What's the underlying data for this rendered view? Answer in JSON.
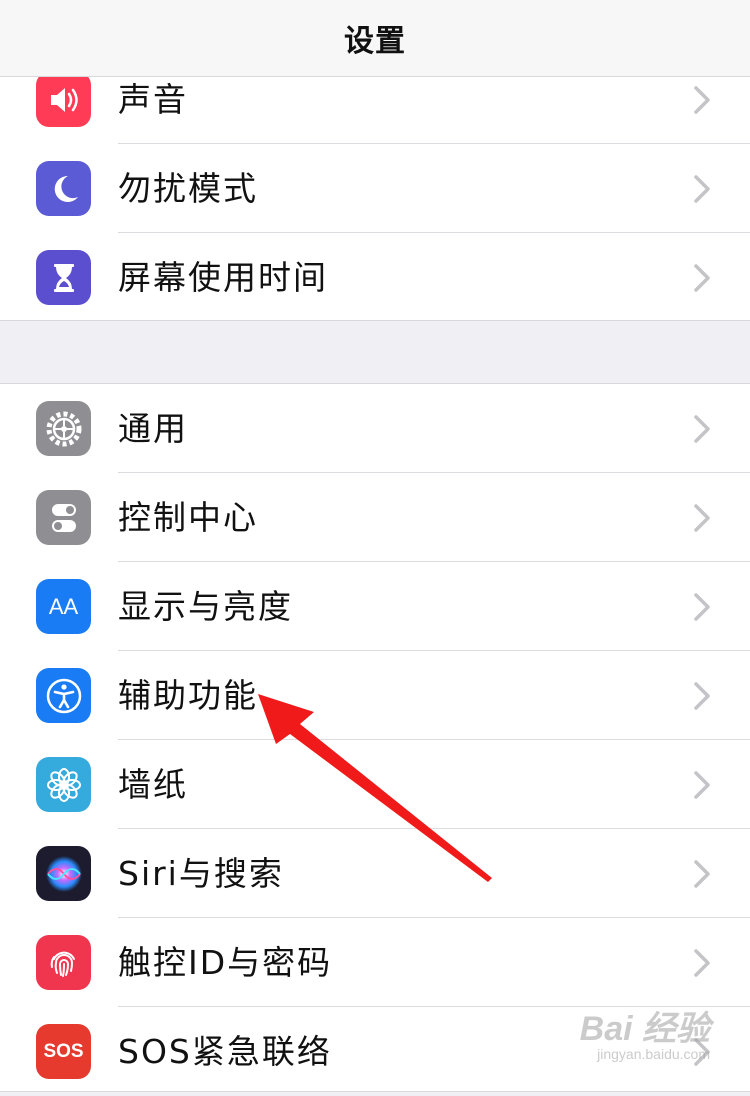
{
  "header": {
    "title": "设置"
  },
  "groups": [
    {
      "items": [
        {
          "label": "声音",
          "icon": "speaker-icon",
          "color": "#ff3b55"
        },
        {
          "label": "勿扰模式",
          "icon": "moon-icon",
          "color": "#5b5bd6"
        },
        {
          "label": "屏幕使用时间",
          "icon": "hourglass-icon",
          "color": "#5b4fcf"
        }
      ]
    },
    {
      "items": [
        {
          "label": "通用",
          "icon": "gear-icon",
          "color": "#8e8e93"
        },
        {
          "label": "控制中心",
          "icon": "toggles-icon",
          "color": "#8e8e93"
        },
        {
          "label": "显示与亮度",
          "icon": "text-size-icon",
          "glyph": "AA",
          "color": "#1a7cf5"
        },
        {
          "label": "辅助功能",
          "icon": "accessibility-icon",
          "color": "#1a7cf5"
        },
        {
          "label": "墙纸",
          "icon": "flower-icon",
          "color": "#35aadc"
        },
        {
          "label": "Siri与搜索",
          "icon": "siri-icon",
          "color": "#1c1c2e"
        },
        {
          "label": "触控ID与密码",
          "icon": "fingerprint-icon",
          "color": "#f0354f"
        },
        {
          "label": "SOS紧急联络",
          "icon": "sos-icon",
          "glyph": "SOS",
          "color": "#e63a2e"
        }
      ]
    }
  ],
  "watermark": {
    "main": "Bai 经验",
    "sub": "jingyan.baidu.com"
  },
  "annotation_color": "#f01a1a"
}
